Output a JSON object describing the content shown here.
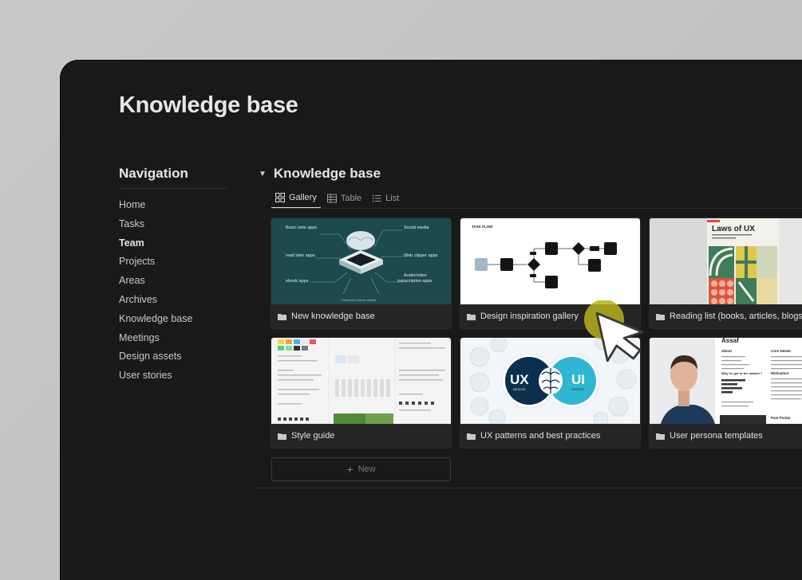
{
  "page": {
    "title": "Knowledge base"
  },
  "navigation": {
    "title": "Navigation",
    "items": [
      {
        "label": "Home"
      },
      {
        "label": "Tasks"
      },
      {
        "label": "Team"
      },
      {
        "label": "Projects"
      },
      {
        "label": "Areas"
      },
      {
        "label": "Archives"
      },
      {
        "label": "Knowledge base"
      },
      {
        "label": "Meetings"
      },
      {
        "label": "Design assets"
      },
      {
        "label": "User stories"
      }
    ]
  },
  "database": {
    "title": "Knowledge base",
    "tabs": [
      {
        "label": "Gallery",
        "icon": "gallery-icon",
        "active": true
      },
      {
        "label": "Table",
        "icon": "table-icon",
        "active": false
      },
      {
        "label": "List",
        "icon": "list-icon",
        "active": false
      }
    ],
    "cards": [
      {
        "title": "New knowledge base",
        "thumb": {
          "labels": [
            "Basic note apps",
            "Social media",
            "read later apps",
            "Web clipper apps",
            "ebook apps",
            "Audio/video",
            "transcription apps"
          ],
          "credit": "Visual by Andrea Valtorti"
        }
      },
      {
        "title": "Design inspiration gallery",
        "thumb": {
          "heading": "TASK FLOW"
        }
      },
      {
        "title": "Reading list (books, articles, blogs)",
        "thumb": {
          "book_title": "Laws of UX"
        }
      },
      {
        "title": "Style guide"
      },
      {
        "title": "UX patterns and best practices",
        "thumb": {
          "left": "UX",
          "right": "UI",
          "sub_left": "DESIGN",
          "sub_right": "DESIGN"
        }
      },
      {
        "title": "User persona templates",
        "thumb": {
          "name": "Assaf",
          "about": "About",
          "why": "Why he got to the market ?",
          "core": "Core Needs",
          "motivation": "Motivation",
          "pain": "Pain Points"
        }
      }
    ],
    "new_label": "New"
  },
  "colors": {
    "background": "#191919",
    "cursor_highlight": "#b7b21c",
    "card_bg": "#252525"
  }
}
